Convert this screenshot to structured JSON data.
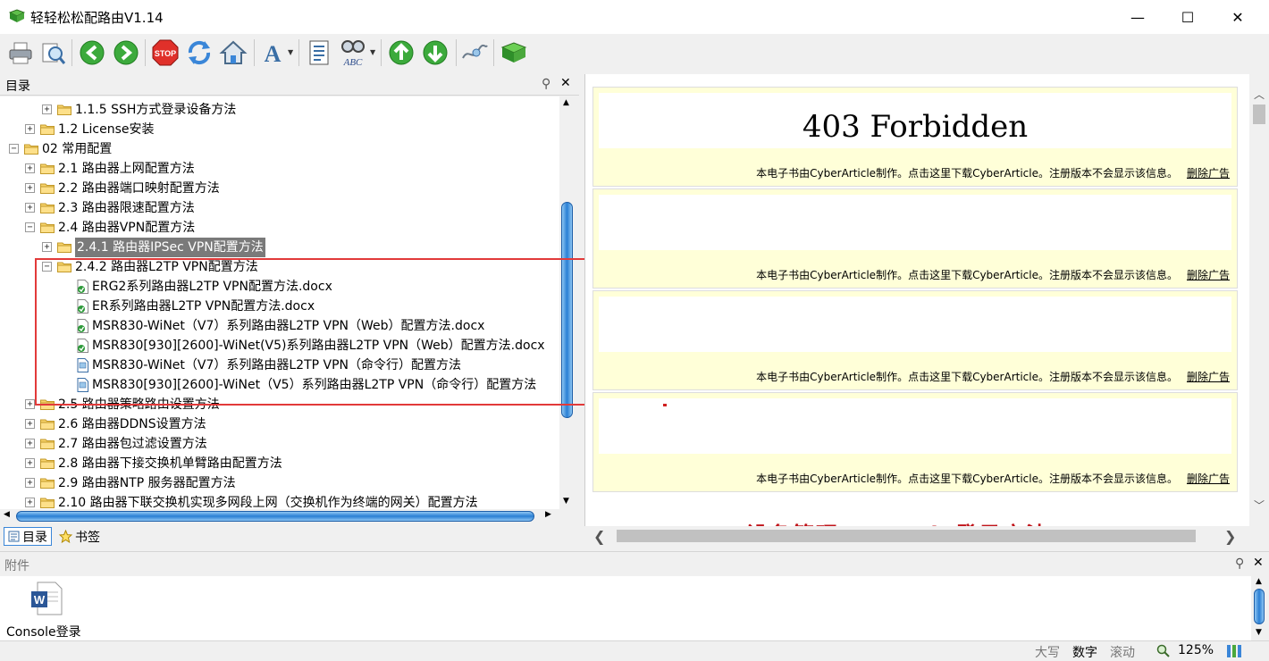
{
  "window": {
    "title": "轻轻松松配路由V1.14",
    "minimize": "—",
    "maximize": "☐",
    "close": "✕"
  },
  "toolbar": {
    "buttons": [
      {
        "name": "print-icon"
      },
      {
        "name": "print-preview-icon"
      },
      {
        "name": "back-icon",
        "color": "#3caa3c"
      },
      {
        "name": "forward-icon",
        "color": "#3caa3c"
      },
      {
        "name": "stop-icon",
        "text": "STOP",
        "color": "#e0302a"
      },
      {
        "name": "refresh-icon",
        "color": "#3a86d8"
      },
      {
        "name": "home-icon"
      },
      {
        "name": "font-icon",
        "text": "A"
      },
      {
        "name": "contents-icon"
      },
      {
        "name": "find-icon",
        "text": "ABC"
      },
      {
        "name": "previous-topic-icon",
        "color": "#3caa3c"
      },
      {
        "name": "next-topic-icon",
        "color": "#3caa3c"
      },
      {
        "name": "link-icon"
      },
      {
        "name": "book-icon"
      }
    ]
  },
  "toc": {
    "title": "目录",
    "items": [
      {
        "label": "1.1.5 SSH方式登录设备方法",
        "level": 2,
        "type": "folder",
        "expander": "+"
      },
      {
        "label": "1.2 License安装",
        "level": 1,
        "type": "folder",
        "expander": "+"
      },
      {
        "label": "02 常用配置",
        "level": 0,
        "type": "folder",
        "expander": "−"
      },
      {
        "label": "2.1 路由器上网配置方法",
        "level": 1,
        "type": "folder",
        "expander": "+"
      },
      {
        "label": "2.2 路由器端口映射配置方法",
        "level": 1,
        "type": "folder",
        "expander": "+"
      },
      {
        "label": "2.3 路由器限速配置方法",
        "level": 1,
        "type": "folder",
        "expander": "+"
      },
      {
        "label": "2.4 路由器VPN配置方法",
        "level": 1,
        "type": "folder",
        "expander": "−"
      },
      {
        "label": "2.4.1 路由器IPSec VPN配置方法",
        "level": 2,
        "type": "folder",
        "expander": "+",
        "selected": true
      },
      {
        "label": "2.4.2 路由器L2TP VPN配置方法",
        "level": 2,
        "type": "folder",
        "expander": "−"
      },
      {
        "label": "ERG2系列路由器L2TP VPN配置方法.docx",
        "level": 3,
        "type": "attach"
      },
      {
        "label": "ER系列路由器L2TP VPN配置方法.docx",
        "level": 3,
        "type": "attach"
      },
      {
        "label": "MSR830-WiNet（V7）系列路由器L2TP VPN（Web）配置方法.docx",
        "level": 3,
        "type": "attach"
      },
      {
        "label": "MSR830[930][2600]-WiNet(V5)系列路由器L2TP VPN（Web）配置方法.docx",
        "level": 3,
        "type": "attach"
      },
      {
        "label": "MSR830-WiNet（V7）系列路由器L2TP VPN（命令行）配置方法",
        "level": 3,
        "type": "page"
      },
      {
        "label": "MSR830[930][2600]-WiNet（V5）系列路由器L2TP VPN（命令行）配置方法",
        "level": 3,
        "type": "page"
      },
      {
        "label": "2.5 路由器策略路由设置方法",
        "level": 1,
        "type": "folder",
        "expander": "+"
      },
      {
        "label": "2.6 路由器DDNS设置方法",
        "level": 1,
        "type": "folder",
        "expander": "+"
      },
      {
        "label": "2.7 路由器包过滤设置方法",
        "level": 1,
        "type": "folder",
        "expander": "+"
      },
      {
        "label": "2.8 路由器下接交换机单臂路由配置方法",
        "level": 1,
        "type": "folder",
        "expander": "+"
      },
      {
        "label": "2.9 路由器NTP 服务器配置方法",
        "level": 1,
        "type": "folder",
        "expander": "+"
      },
      {
        "label": "2.10 路由器下联交换机实现多网段上网（交换机作为终端的网关）配置方法",
        "level": 1,
        "type": "folder",
        "expander": "+"
      }
    ]
  },
  "tabs": [
    {
      "label": "目录",
      "active": true
    },
    {
      "label": "书签",
      "active": false
    }
  ],
  "content": {
    "heading": "403 Forbidden",
    "footer_text": "本电子书由CyberArticle制作。点击这里下载CyberArticle。注册版本不会显示该信息。",
    "delete_ad": "删除广告",
    "cut_heading": "设备管理 Console登录方法"
  },
  "attachments": {
    "title": "附件",
    "items": [
      {
        "label": "Console登录",
        "icon": "word-doc-icon"
      }
    ]
  },
  "status": {
    "caps": "大写",
    "num": "数字",
    "scroll": "滚动",
    "zoom": "125%"
  }
}
